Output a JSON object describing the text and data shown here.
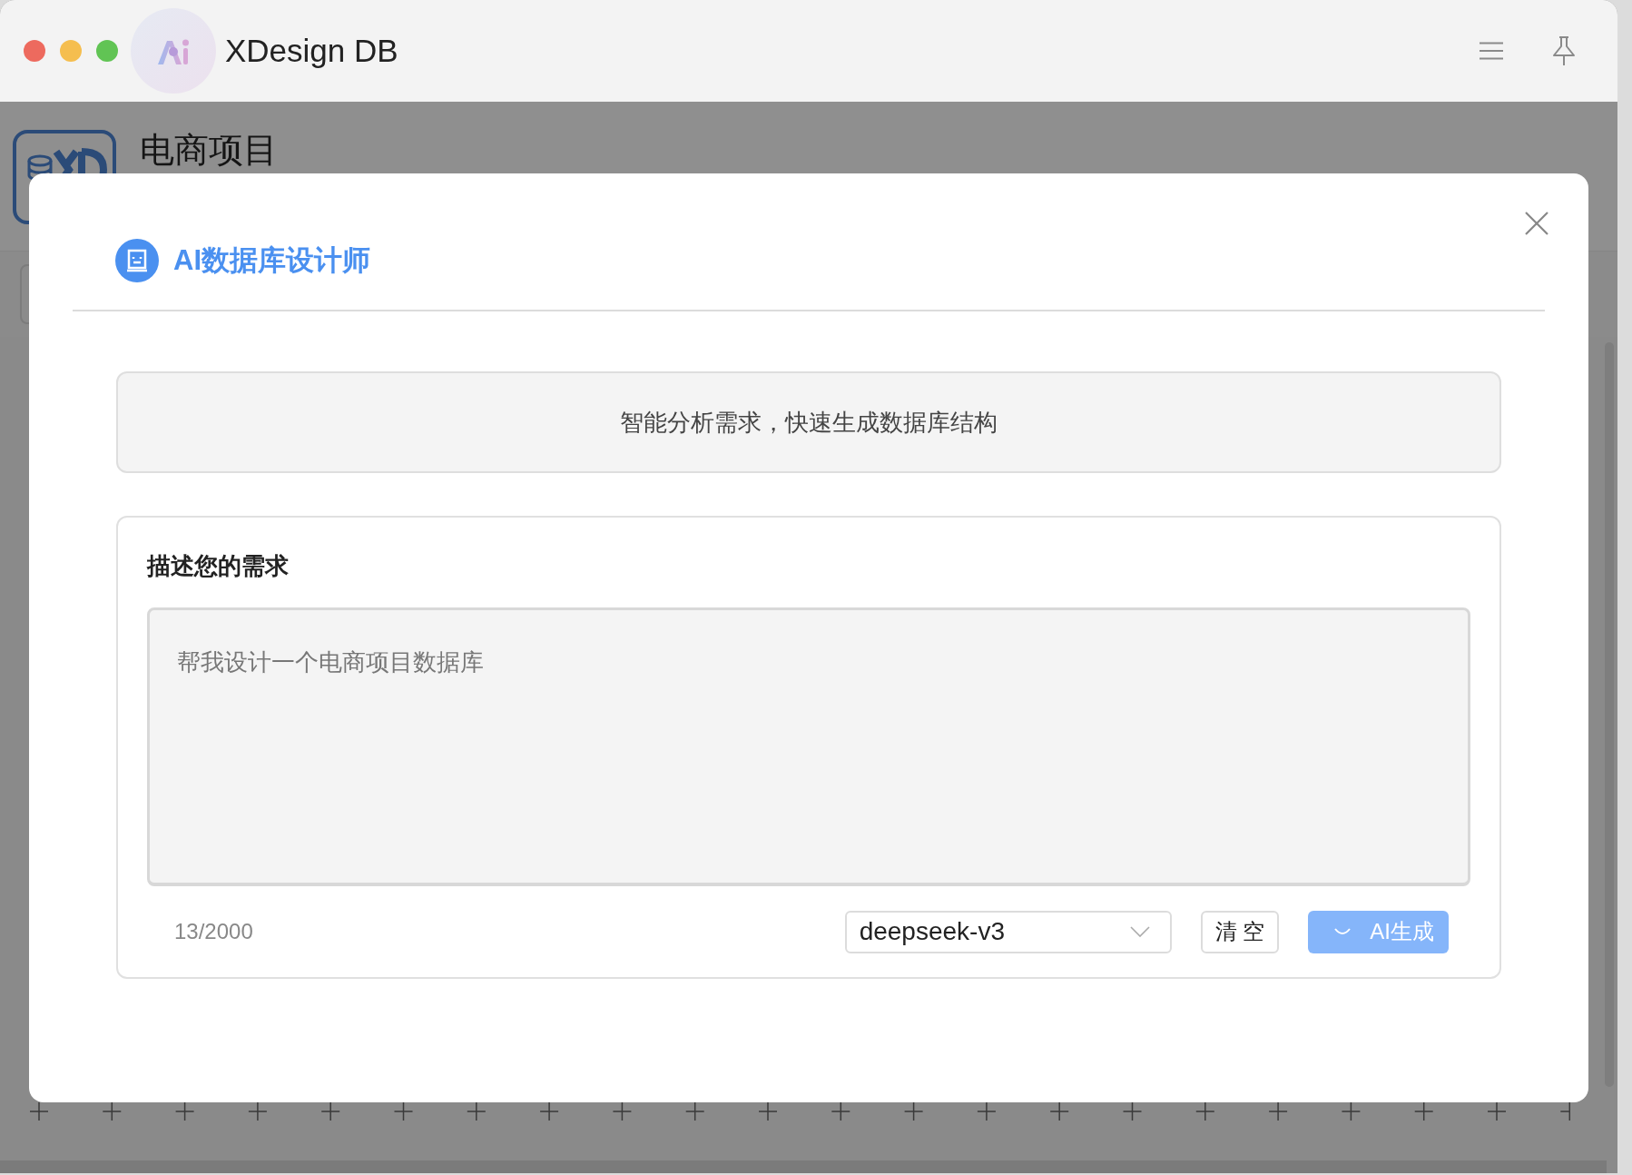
{
  "window": {
    "title": "XDesign DB"
  },
  "project": {
    "title": "电商项目"
  },
  "dialog": {
    "title": "AI数据库设计师",
    "banner": "智能分析需求，快速生成数据库结构",
    "section_title": "描述您的需求",
    "request": {
      "value": "帮我设计一个电商项目数据库",
      "count": "13/2000"
    },
    "model_select": {
      "value": "deepseek-v3"
    },
    "buttons": [
      {
        "kind": "clear",
        "label": "清 空",
        "loading": false
      },
      {
        "kind": "generate",
        "label": "AI生成",
        "loading": true
      }
    ]
  }
}
